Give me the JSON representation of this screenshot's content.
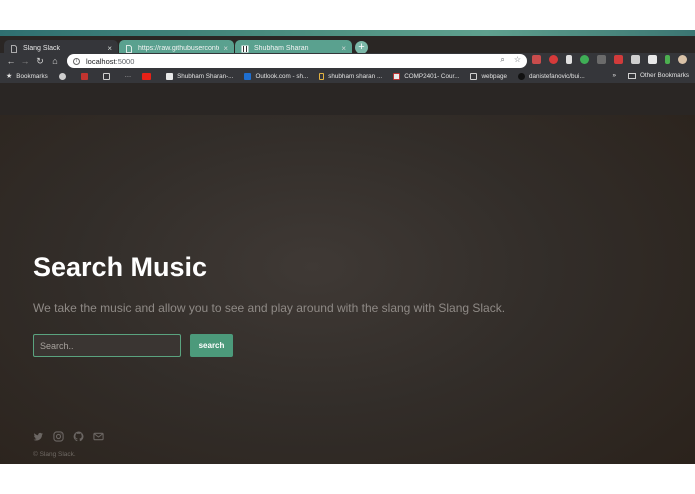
{
  "browser": {
    "tabs": [
      {
        "label": "Slang Slack",
        "icon": "document-icon",
        "active": true
      },
      {
        "label": "https://raw.githubuserconten",
        "icon": "document-icon",
        "active": false
      },
      {
        "label": "Shubham Sharan",
        "icon": "stripes-icon",
        "active": false
      }
    ],
    "newtab_label": "+",
    "close_glyph": "×",
    "url_host": "localhost",
    "url_port": ":5000",
    "bookmarks": [
      {
        "label": "Bookmarks",
        "icon": "star-icon"
      },
      {
        "label": "",
        "icon": "apple-icon"
      },
      {
        "label": "",
        "icon": "red-logo-icon"
      },
      {
        "label": "",
        "icon": "document-icon"
      },
      {
        "label": "···",
        "icon": ""
      },
      {
        "label": "",
        "icon": "youtube-icon"
      },
      {
        "label": "Shubham Sharan-...",
        "icon": "stripes-icon"
      },
      {
        "label": "Outlook.com - sh...",
        "icon": "outlook-icon"
      },
      {
        "label": "shubham sharan ...",
        "icon": "bookmark-icon"
      },
      {
        "label": "COMP2401- Cour...",
        "icon": "course-icon"
      },
      {
        "label": "webpage",
        "icon": "document-icon"
      },
      {
        "label": "danistefanovic/bui...",
        "icon": "github-icon"
      }
    ],
    "bookmarks_more": "»",
    "other_bookmarks": "Other Bookmarks",
    "colors": {
      "toolbar": "#35363a",
      "inactive_tab": "#5aa18f"
    }
  },
  "page": {
    "title": "Search Music",
    "subtitle": "We take the music and allow you to see and play around with the slang with Slang Slack.",
    "search_placeholder": "Search..",
    "search_button": "search",
    "social_icons": [
      "twitter-icon",
      "instagram-icon",
      "github-icon",
      "mail-icon"
    ],
    "copyright": "© Slang Slack.",
    "colors": {
      "accent": "#4c9a7b",
      "title": "#ffffff",
      "subtitle": "#8f8a86"
    }
  }
}
